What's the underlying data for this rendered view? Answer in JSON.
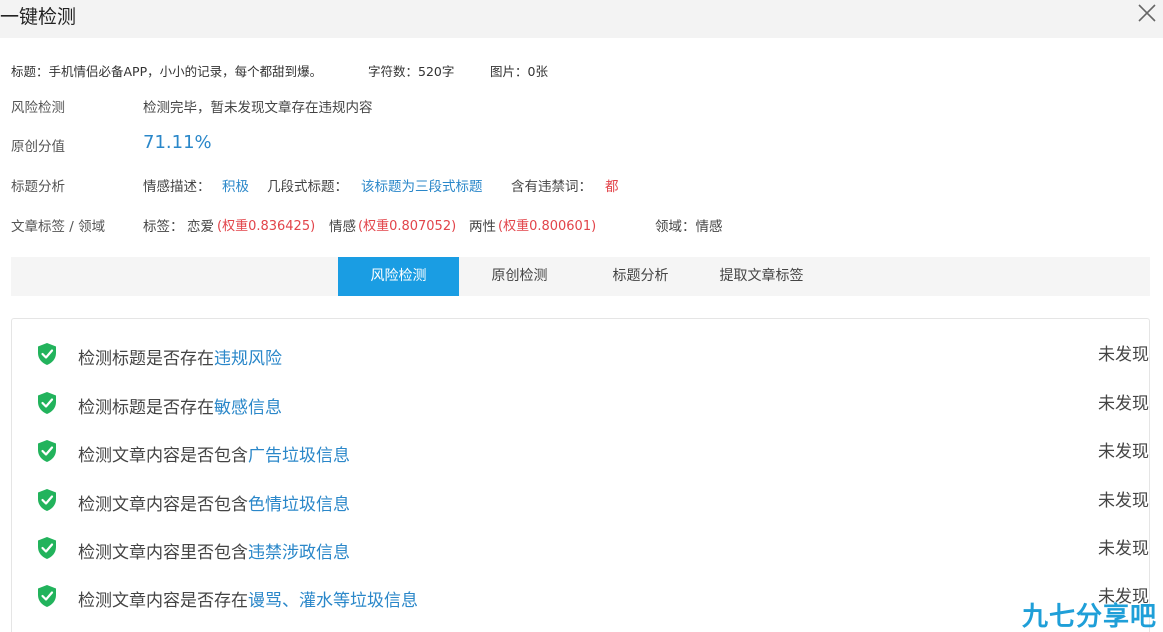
{
  "window": {
    "title": "一键检测",
    "close_icon": "close-icon"
  },
  "meta": {
    "title_text": "标题：手机情侣必备APP，小小的记录，每个都甜到爆。",
    "char_count": "字符数：520字",
    "image_count": "图片：0张"
  },
  "risk": {
    "label": "风险检测",
    "value": "检测完毕，暂未发现文章存在违规内容"
  },
  "original": {
    "label": "原创分值",
    "value": "71.11%"
  },
  "title_analysis": {
    "label": "标题分析",
    "sentiment_label": "情感描述：",
    "sentiment_value": "积极",
    "segments_label": "几段式标题：",
    "segments_value": "该标题为三段式标题",
    "banned_label": "含有违禁词：",
    "banned_value": "都"
  },
  "tags": {
    "label": "文章标签 / 领域",
    "prefix": "标签：",
    "items": [
      {
        "name": "恋爱",
        "weight": "(权重0.836425)"
      },
      {
        "name": "情感",
        "weight": "(权重0.807052)"
      },
      {
        "name": "两性",
        "weight": "(权重0.800601)"
      }
    ],
    "domain": "领域：情感"
  },
  "tabs": [
    {
      "label": "风险检测",
      "active": true
    },
    {
      "label": "原创检测",
      "active": false
    },
    {
      "label": "标题分析",
      "active": false
    },
    {
      "label": "提取文章标签",
      "active": false
    }
  ],
  "checks": [
    {
      "prefix": "检测标题是否存在",
      "highlight": "违规风险",
      "status": "未发现"
    },
    {
      "prefix": "检测标题是否存在",
      "highlight": "敏感信息",
      "status": "未发现"
    },
    {
      "prefix": "检测文章内容是否包含",
      "highlight": "广告垃圾信息",
      "status": "未发现"
    },
    {
      "prefix": "检测文章内容是否包含",
      "highlight": "色情垃圾信息",
      "status": "未发现"
    },
    {
      "prefix": "检测文章内容里否包含",
      "highlight": "违禁涉政信息",
      "status": "未发现"
    },
    {
      "prefix": "检测文章内容是否存在",
      "highlight": "谩骂、灌水等垃圾信息",
      "status": "未发现"
    }
  ],
  "colors": {
    "accent": "#1a9de3",
    "link": "#2a87c9",
    "danger": "#e2444a",
    "ok": "#22b35c"
  },
  "watermark": "九七分享吧"
}
